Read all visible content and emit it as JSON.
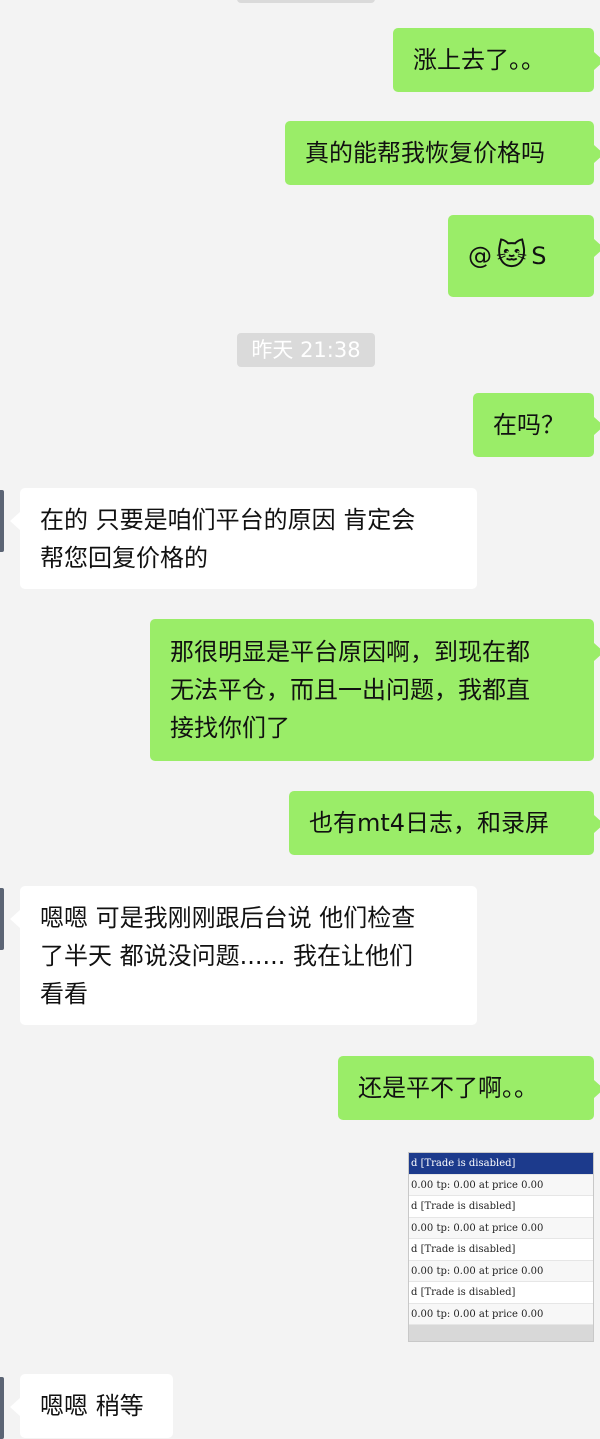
{
  "top_time_partial": "",
  "time_divider": "昨天 21:38",
  "messages": {
    "m1": "涨上去了。。",
    "m2": "真的能帮我恢复价格吗",
    "m3_prefix": "@",
    "m3_emoji": "🐱",
    "m3_suffix": "S",
    "m4": "在吗？",
    "m5_line1": "在的 只要是咱们平台的原因 肯定会",
    "m5_line2": "帮您回复价格的",
    "m6_line1": "那很明显是平台原因啊，到现在都",
    "m6_line2": "无法平仓，而且一出问题，我都直",
    "m6_line3": "接找你们了",
    "m7": "也有mt4日志，和录屏",
    "m8_line1": "嗯嗯 可是我刚刚跟后台说 他们检查",
    "m8_line2": "了半天 都说没问题...... 我在让他们",
    "m8_line3": "看看",
    "m9": "还是平不了啊。。",
    "m11": "嗯嗯 稍等"
  },
  "screenshot_rows": [
    "d [Trade is disabled]",
    "0.00 tp: 0.00 at price 0.00",
    "d [Trade is disabled]",
    "0.00 tp: 0.00 at price 0.00",
    "d [Trade is disabled]",
    "0.00 tp: 0.00 at price 0.00",
    "d [Trade is disabled]",
    "0.00 tp: 0.00 at price 0.00"
  ],
  "colors": {
    "background": "#f3f3f3",
    "my_bubble": "#9aed68",
    "their_bubble": "#ffffff",
    "time_chip": "#dadada",
    "selected_row": "#1c3a8c"
  }
}
